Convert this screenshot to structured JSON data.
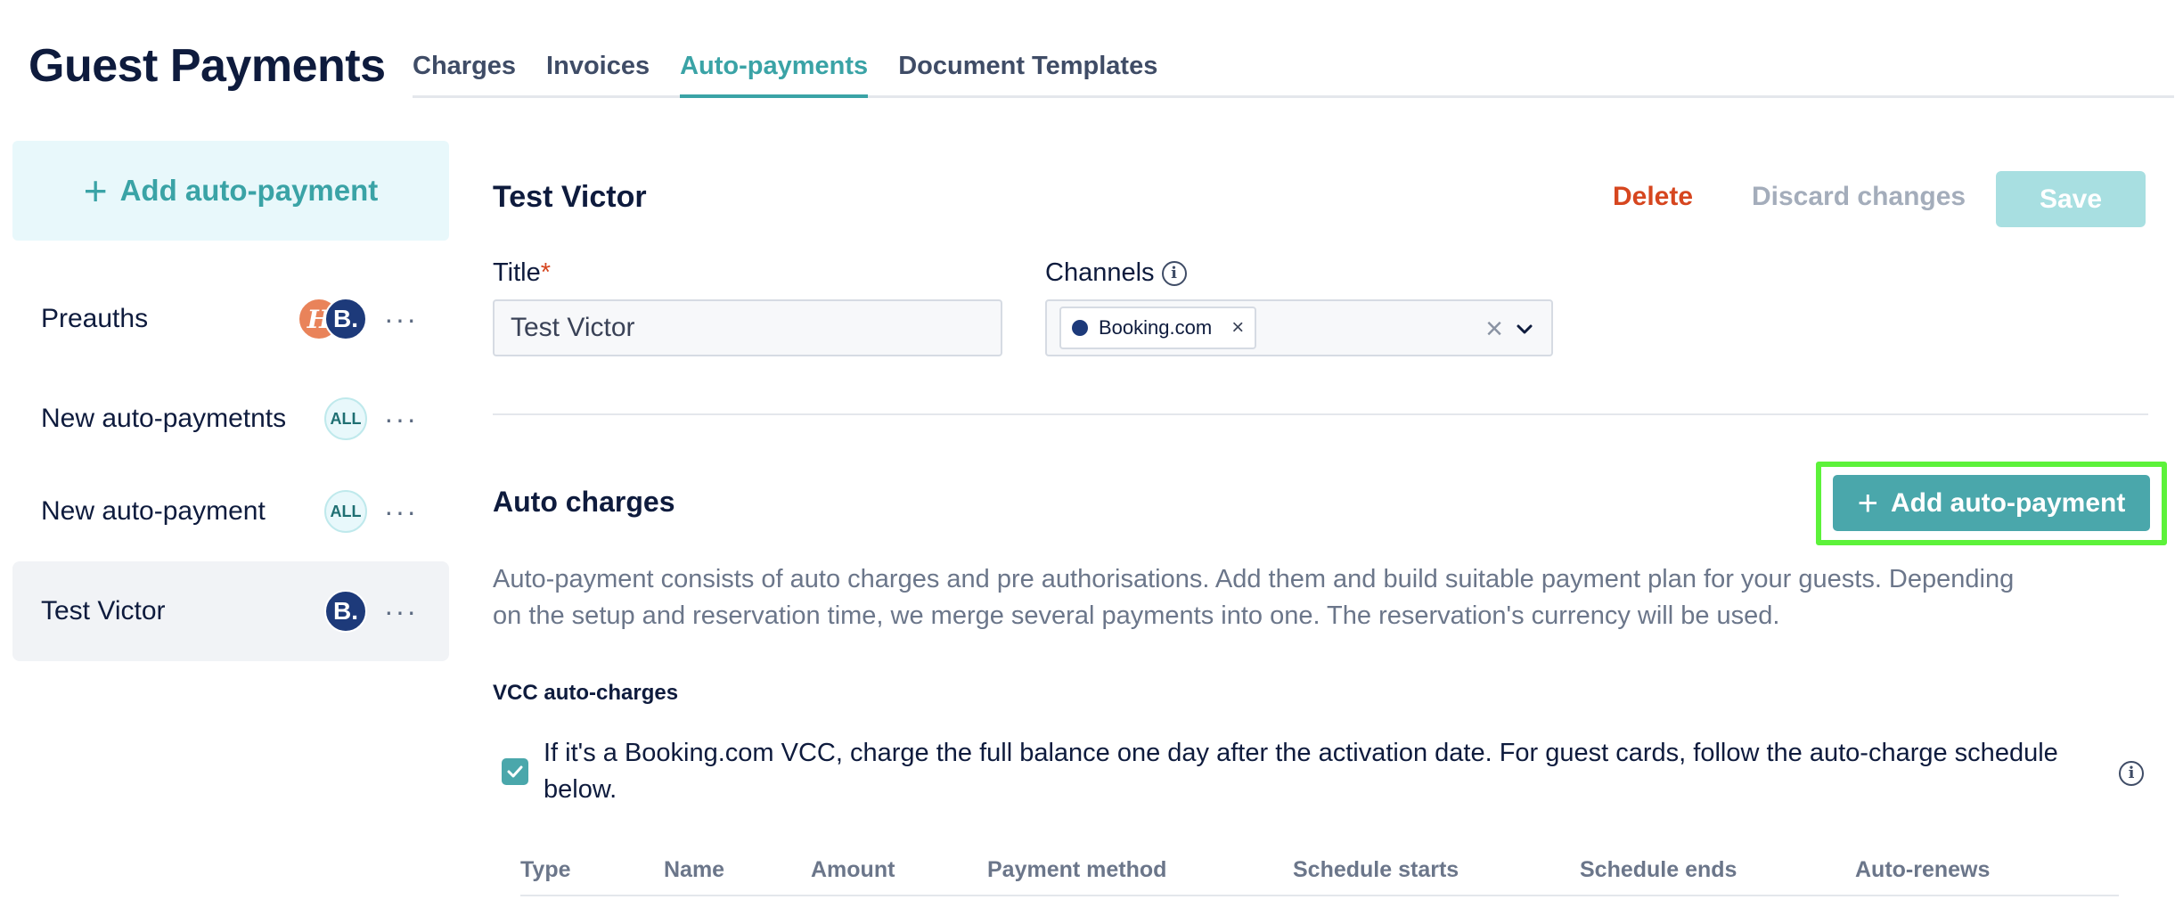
{
  "header": {
    "title": "Guest Payments",
    "tabs": [
      {
        "label": "Charges"
      },
      {
        "label": "Invoices"
      },
      {
        "label": "Auto-payments",
        "active": true
      },
      {
        "label": "Document Templates"
      }
    ]
  },
  "sidebar": {
    "add_label": "Add auto-payment",
    "items": [
      {
        "label": "Preauths",
        "badges": [
          "H",
          "B."
        ]
      },
      {
        "label": "New auto-paymetnts",
        "badges": [
          "ALL"
        ]
      },
      {
        "label": "New auto-payment",
        "badges": [
          "ALL"
        ]
      },
      {
        "label": "Test Victor",
        "badges": [
          "B."
        ],
        "active": true
      }
    ],
    "more_glyph": "···"
  },
  "detail": {
    "title": "Test Victor",
    "delete_label": "Delete",
    "discard_label": "Discard changes",
    "save_label": "Save",
    "title_field": {
      "label": "Title",
      "required_mark": "*",
      "value": "Test Victor"
    },
    "channels_field": {
      "label": "Channels",
      "selected": [
        "Booking.com"
      ]
    }
  },
  "auto_charges": {
    "title": "Auto charges",
    "add_button_label": "Add auto-payment",
    "description": "Auto-payment consists of auto charges and pre authorisations. Add them and build suitable payment plan for your guests. Depending on the setup and reservation time, we merge several payments into one. The reservation's currency will be used.",
    "vcc_title": "VCC auto-charges",
    "vcc_checkbox_checked": true,
    "vcc_checkbox_text": "If it's a Booking.com VCC, charge the full balance one day after the activation date. For guest cards, follow the auto-charge schedule below.",
    "table_headers": [
      "Type",
      "Name",
      "Amount",
      "Payment method",
      "Schedule starts",
      "Schedule ends",
      "Auto-renews"
    ]
  },
  "colors": {
    "accent": "#3aa3a6",
    "danger": "#d6461f",
    "highlight": "#5cf23a",
    "text": "#0e1b3d"
  }
}
